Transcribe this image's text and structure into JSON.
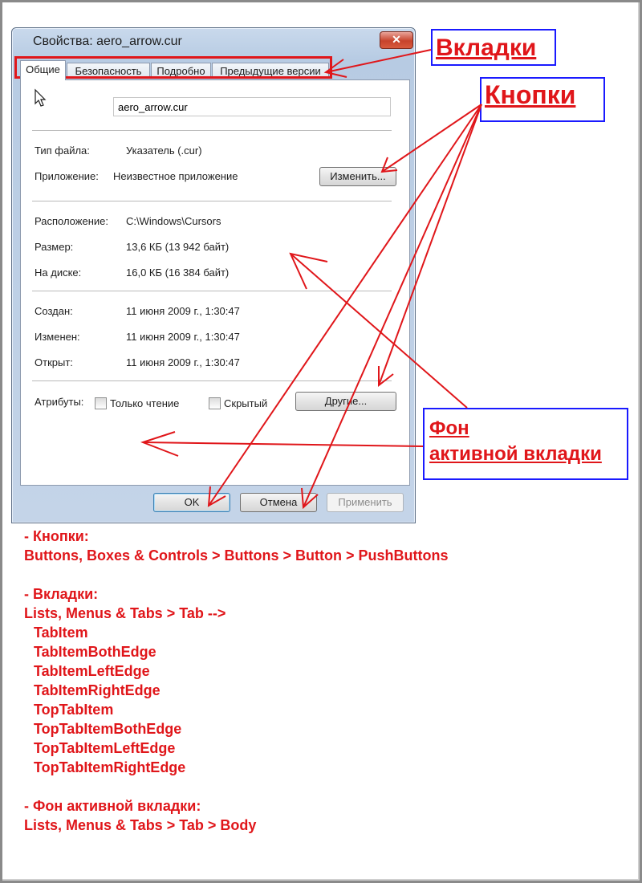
{
  "window": {
    "title": "Свойства: aero_arrow.cur",
    "close_glyph": "✕"
  },
  "tabs": [
    {
      "label": "Общие",
      "active": true
    },
    {
      "label": "Безопасность",
      "active": false
    },
    {
      "label": "Подробно",
      "active": false
    },
    {
      "label": "Предыдущие версии",
      "active": false
    }
  ],
  "general": {
    "filename": "aero_arrow.cur",
    "file_type_label": "Тип файла:",
    "file_type_value": "Указатель (.cur)",
    "app_label": "Приложение:",
    "app_value": "Неизвестное приложение",
    "change_button": "Изменить...",
    "location_label": "Расположение:",
    "location_value": "C:\\Windows\\Cursors",
    "size_label": "Размер:",
    "size_value": "13,6 КБ (13 942 байт)",
    "disk_label": "На диске:",
    "disk_value": "16,0 КБ (16 384 байт)",
    "created_label": "Создан:",
    "created_value": "11 июня 2009 г., 1:30:47",
    "modified_label": "Изменен:",
    "modified_value": "11 июня 2009 г., 1:30:47",
    "opened_label": "Открыт:",
    "opened_value": "11 июня 2009 г., 1:30:47",
    "attributes_label": "Атрибуты:",
    "readonly_label": "Только чтение",
    "hidden_label": "Скрытый",
    "other_button": "Другие..."
  },
  "footer": {
    "ok": "OK",
    "cancel": "Отмена",
    "apply": "Применить"
  },
  "callouts": {
    "tabs": "Вкладки",
    "buttons": "Кнопки",
    "bg_line1": "Фон",
    "bg_line2": "активной вкладки"
  },
  "notes": [
    " - Кнопки:",
    "Buttons, Boxes & Controls > Buttons > Button > PushButtons",
    "",
    " - Вкладки:",
    "Lists, Menus & Tabs > Tab -->",
    "  TabItem",
    "  TabItemBothEdge",
    "  TabItemLeftEdge",
    "  TabItemRightEdge",
    "  TopTabItem",
    "  TopTabItemBothEdge",
    "  TopTabItemLeftEdge",
    "  TopTabItemRightEdge",
    "",
    " - Фон активной вкладки:",
    "Lists, Menus & Tabs > Tab > Body"
  ],
  "colors": {
    "annotation_red": "#e0161a",
    "annotation_blue": "#1a1aff"
  }
}
